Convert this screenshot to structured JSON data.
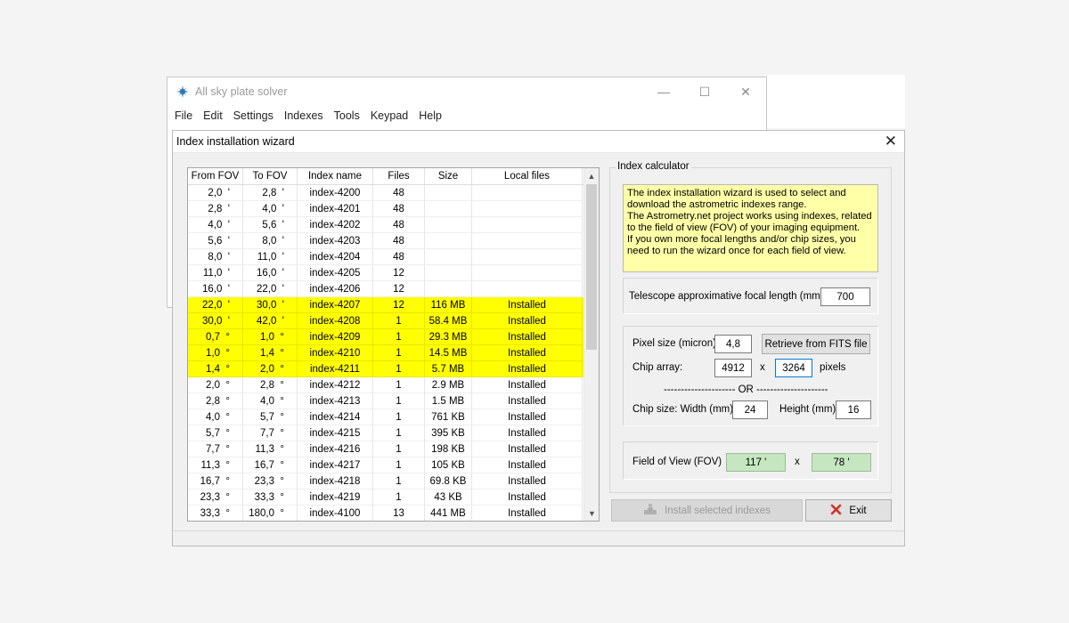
{
  "main_window": {
    "title": "All sky plate solver",
    "controls": {
      "minimize": "—",
      "maximize": "☐",
      "close": "✕"
    },
    "menu": [
      "File",
      "Edit",
      "Settings",
      "Indexes",
      "Tools",
      "Keypad",
      "Help"
    ]
  },
  "dialog": {
    "title": "Index installation wizard",
    "close": "✕"
  },
  "table": {
    "columns": [
      "From FOV",
      "To FOV",
      "Index name",
      "Files",
      "Size",
      "Local files"
    ],
    "rows": [
      {
        "from": "2,0  '",
        "to": "2,8  '",
        "name": "index-4200",
        "files": "48",
        "size": "",
        "local": "",
        "selected": false
      },
      {
        "from": "2,8  '",
        "to": "4,0  '",
        "name": "index-4201",
        "files": "48",
        "size": "",
        "local": "",
        "selected": false
      },
      {
        "from": "4,0  '",
        "to": "5,6  '",
        "name": "index-4202",
        "files": "48",
        "size": "",
        "local": "",
        "selected": false
      },
      {
        "from": "5,6  '",
        "to": "8,0  '",
        "name": "index-4203",
        "files": "48",
        "size": "",
        "local": "",
        "selected": false
      },
      {
        "from": "8,0  '",
        "to": "11,0  '",
        "name": "index-4204",
        "files": "48",
        "size": "",
        "local": "",
        "selected": false
      },
      {
        "from": "11,0  '",
        "to": "16,0  '",
        "name": "index-4205",
        "files": "12",
        "size": "",
        "local": "",
        "selected": false
      },
      {
        "from": "16,0  '",
        "to": "22,0  '",
        "name": "index-4206",
        "files": "12",
        "size": "",
        "local": "",
        "selected": false
      },
      {
        "from": "22,0  '",
        "to": "30,0  '",
        "name": "index-4207",
        "files": "12",
        "size": "116 MB",
        "local": "Installed",
        "selected": true
      },
      {
        "from": "30,0  '",
        "to": "42,0  '",
        "name": "index-4208",
        "files": "1",
        "size": "58.4 MB",
        "local": "Installed",
        "selected": true
      },
      {
        "from": "0,7  °",
        "to": "1,0  °",
        "name": "index-4209",
        "files": "1",
        "size": "29.3 MB",
        "local": "Installed",
        "selected": true
      },
      {
        "from": "1,0  °",
        "to": "1,4  °",
        "name": "index-4210",
        "files": "1",
        "size": "14.5 MB",
        "local": "Installed",
        "selected": true
      },
      {
        "from": "1,4  °",
        "to": "2,0  °",
        "name": "index-4211",
        "files": "1",
        "size": "5.7 MB",
        "local": "Installed",
        "selected": true
      },
      {
        "from": "2,0  °",
        "to": "2,8  °",
        "name": "index-4212",
        "files": "1",
        "size": "2.9 MB",
        "local": "Installed",
        "selected": false
      },
      {
        "from": "2,8  °",
        "to": "4,0  °",
        "name": "index-4213",
        "files": "1",
        "size": "1.5 MB",
        "local": "Installed",
        "selected": false
      },
      {
        "from": "4,0  °",
        "to": "5,7  °",
        "name": "index-4214",
        "files": "1",
        "size": "761 KB",
        "local": "Installed",
        "selected": false
      },
      {
        "from": "5,7  °",
        "to": "7,7  °",
        "name": "index-4215",
        "files": "1",
        "size": "395 KB",
        "local": "Installed",
        "selected": false
      },
      {
        "from": "7,7  °",
        "to": "11,3  °",
        "name": "index-4216",
        "files": "1",
        "size": "198 KB",
        "local": "Installed",
        "selected": false
      },
      {
        "from": "11,3  °",
        "to": "16,7  °",
        "name": "index-4217",
        "files": "1",
        "size": "105 KB",
        "local": "Installed",
        "selected": false
      },
      {
        "from": "16,7  °",
        "to": "23,3  °",
        "name": "index-4218",
        "files": "1",
        "size": "69.8 KB",
        "local": "Installed",
        "selected": false
      },
      {
        "from": "23,3  °",
        "to": "33,3  °",
        "name": "index-4219",
        "files": "1",
        "size": "43 KB",
        "local": "Installed",
        "selected": false
      },
      {
        "from": "33,3  °",
        "to": "180,0  °",
        "name": "index-4100",
        "files": "13",
        "size": "441 MB",
        "local": "Installed",
        "selected": false
      }
    ]
  },
  "calculator": {
    "legend": "Index calculator",
    "info_lines": [
      "The index installation wizard is used to select and",
      "download the astrometric indexes range.",
      "The Astrometry.net project works using indexes, related",
      "to the field of view (FOV) of your imaging equipment.",
      "If you own more focal lengths and/or chip sizes, you",
      "need to run the wizard once for each field of view."
    ],
    "focal_label": "Telescope approximative focal length (mm)",
    "focal_value": "700",
    "pixel_label": "Pixel size (micron)",
    "pixel_value": "4,8",
    "retrieve_button": "Retrieve from FITS file",
    "chip_array_label": "Chip array:",
    "chip_w": "4912",
    "chip_x": "x",
    "chip_h": "3264",
    "pixels_label": "pixels",
    "or_separator": "--------------------- OR ---------------------",
    "chip_size_label": "Chip size:  Width (mm)",
    "width_value": "24",
    "height_label": "Height (mm)",
    "height_value": "16",
    "fov_label": "Field of View  (FOV)",
    "fov_w": "117 '",
    "fov_x": "x",
    "fov_h": "78 '"
  },
  "buttons": {
    "install": "Install selected indexes",
    "exit": "Exit"
  },
  "colors": {
    "selected_row": "#ffff00",
    "info_box": "#ffffa8",
    "fov_field": "#c5e6c0",
    "exit_icon": "#d0302a"
  }
}
